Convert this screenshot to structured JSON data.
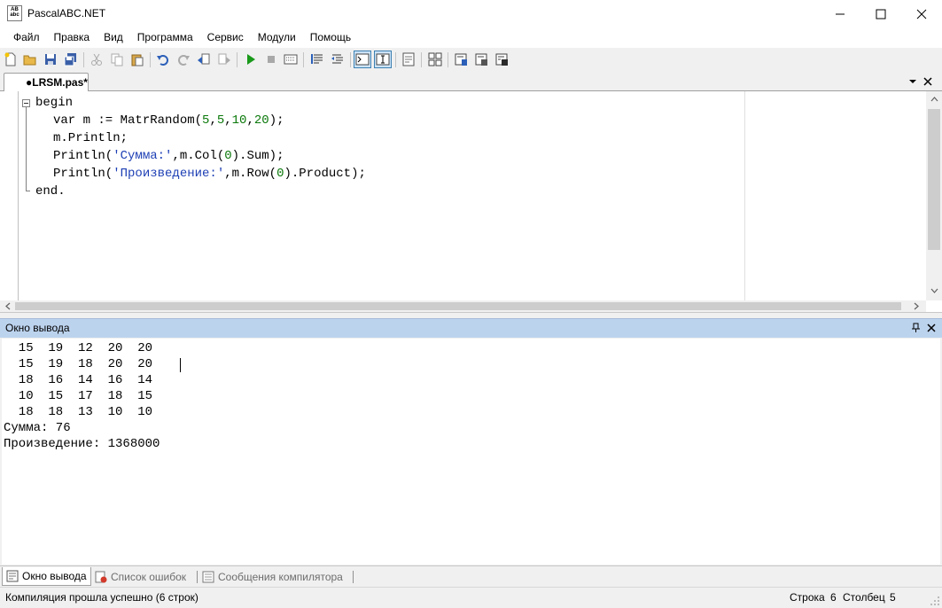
{
  "window": {
    "title": "PascalABC.NET",
    "icon_text": "AB abc"
  },
  "menu": {
    "items": [
      "Файл",
      "Правка",
      "Вид",
      "Программа",
      "Сервис",
      "Модули",
      "Помощь"
    ]
  },
  "toolbar": {
    "icons": [
      "new-file-icon",
      "open-folder-icon",
      "save-icon",
      "save-all-icon",
      "cut-icon",
      "copy-icon",
      "paste-icon",
      "undo-icon",
      "redo-icon",
      "navigate-back-icon",
      "navigate-forward-icon",
      "run-icon",
      "stop-icon",
      "compile-icon",
      "comment-icon",
      "uncomment-icon",
      "console-output-icon",
      "text-output-icon",
      "debug-window-icon",
      "form-designer-icon",
      "format-code-icon",
      "code-template-icon",
      "references-icon"
    ]
  },
  "editor": {
    "tab_label": "●LRSM.pas*",
    "code": {
      "line1": "begin",
      "line2": {
        "a": "var m := MatrRandom(",
        "n1": "5",
        "c1": ",",
        "n2": "5",
        "c2": ",",
        "n3": "10",
        "c3": ",",
        "n4": "20",
        "b": ");"
      },
      "line3": "m.Println;",
      "line4": {
        "a": "Println(",
        "s": "'Сумма:'",
        "b": ",m.Col(",
        "n": "0",
        "c": ").Sum);"
      },
      "line5": {
        "a": "Println(",
        "s": "'Произведение:'",
        "b": ",m.Row(",
        "n": "0",
        "c": ").Product);"
      },
      "line6": "end."
    }
  },
  "output_panel": {
    "title": "Окно вывода",
    "lines": [
      "  15  19  12  20  20",
      "  15  19  18  20  20",
      "  18  16  14  16  14",
      "  10  15  17  18  15",
      "  18  18  13  10  10",
      "Сумма: 76",
      "Произведение: 1368000"
    ]
  },
  "bottom_tabs": {
    "output": "Окно вывода",
    "errors": "Список ошибок",
    "compiler": "Сообщения компилятора"
  },
  "status": {
    "message": "Компиляция прошла успешно (6 строк)",
    "row_label": "Строка",
    "row_value": "6",
    "col_label": "Столбец",
    "col_value": "5"
  },
  "colors": {
    "string": "#1d3fb4",
    "number": "#097809",
    "panel_header": "#bcd3ee"
  }
}
